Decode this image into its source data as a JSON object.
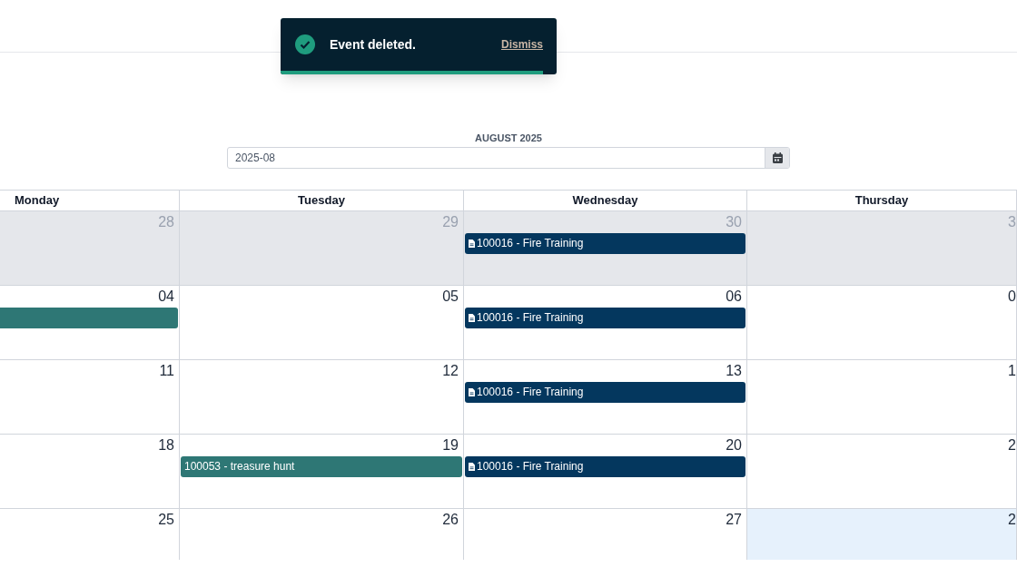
{
  "toast": {
    "message": "Event deleted.",
    "dismiss": "Dismiss",
    "level": 0.95
  },
  "month_picker": {
    "label": "AUGUST 2025",
    "value": "2025-08"
  },
  "calendar": {
    "columns": [
      "Monday",
      "Tuesday",
      "Wednesday",
      "Thursday"
    ],
    "weeks": [
      [
        {
          "date": "28",
          "outside_month": true,
          "today": false
        },
        {
          "date": "29",
          "outside_month": true,
          "today": false
        },
        {
          "date": "30",
          "outside_month": true,
          "today": false,
          "events": [
            {
              "kind": "document",
              "label": "100016 - Fire Training",
              "color": "#04375e"
            }
          ]
        },
        {
          "date": "3",
          "outside_month": true,
          "today": false
        }
      ],
      [
        {
          "date": "04",
          "outside_month": false,
          "today": false,
          "events": [
            {
              "kind": "plain",
              "color": "#2e7775"
            }
          ]
        },
        {
          "date": "05",
          "outside_month": false,
          "today": false
        },
        {
          "date": "06",
          "outside_month": false,
          "today": false,
          "events": [
            {
              "kind": "document",
              "label": "100016 - Fire Training",
              "color": "#04375e"
            }
          ]
        },
        {
          "date": "0",
          "outside_month": false,
          "today": false
        }
      ],
      [
        {
          "date": "11",
          "outside_month": false,
          "today": false
        },
        {
          "date": "12",
          "outside_month": false,
          "today": false
        },
        {
          "date": "13",
          "outside_month": false,
          "today": false,
          "events": [
            {
              "kind": "document",
              "label": "100016 - Fire Training",
              "color": "#04375e"
            }
          ]
        },
        {
          "date": "1",
          "outside_month": false,
          "today": false
        }
      ],
      [
        {
          "date": "18",
          "outside_month": false,
          "today": false
        },
        {
          "date": "19",
          "outside_month": false,
          "today": false,
          "events": [
            {
              "kind": "plain",
              "label": "100053 - treasure hunt",
              "color": "#2e7775"
            }
          ]
        },
        {
          "date": "20",
          "outside_month": false,
          "today": false,
          "events": [
            {
              "kind": "document",
              "label": "100016 - Fire Training",
              "color": "#04375e"
            }
          ]
        },
        {
          "date": "2",
          "outside_month": false,
          "today": false
        }
      ],
      [
        {
          "date": "25",
          "outside_month": false,
          "today": false
        },
        {
          "date": "26",
          "outside_month": false,
          "today": false
        },
        {
          "date": "27",
          "outside_month": false,
          "today": false
        },
        {
          "date": "2",
          "outside_month": false,
          "today": true
        }
      ]
    ]
  }
}
